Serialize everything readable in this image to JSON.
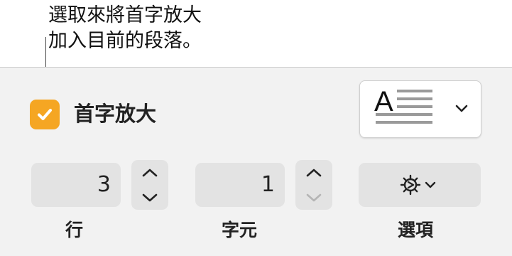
{
  "callout": {
    "line1": "選取來將首字放大",
    "line2": "加入目前的段落。"
  },
  "drop_cap": {
    "checkbox_label": "首字放大",
    "checked": true,
    "accent_color": "#f5a623",
    "style_preview_letter": "A"
  },
  "lines": {
    "value": "3",
    "caption": "行"
  },
  "characters": {
    "value": "1",
    "caption": "字元"
  },
  "options": {
    "caption": "選項"
  },
  "icons": [
    "checkmark-icon",
    "chevron-down-icon",
    "chevron-up-icon",
    "gear-icon"
  ]
}
